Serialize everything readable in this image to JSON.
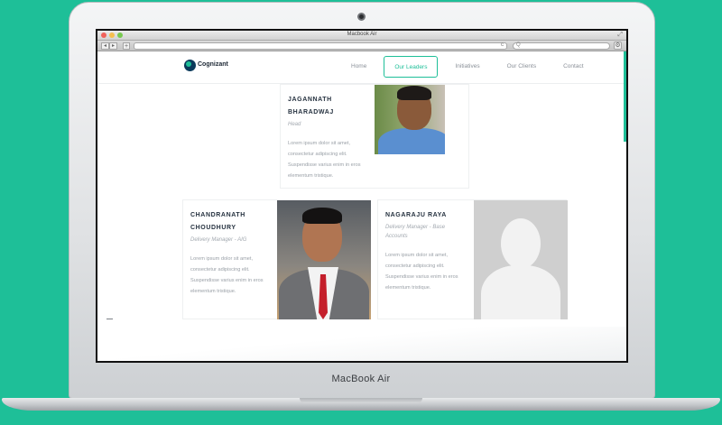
{
  "device": {
    "brand_label": "MacBook Air"
  },
  "browser": {
    "window_title": "Macbook Air",
    "back_icon": "chevron-left-icon",
    "forward_icon": "chevron-right-icon",
    "new_tab_symbol": "+",
    "reload_symbol": "c",
    "search_symbol": "Q",
    "settings_symbol": "⚙"
  },
  "site": {
    "logo_text": "Cognizant",
    "nav": [
      {
        "label": "Home",
        "active": false
      },
      {
        "label": "Our Leaders",
        "active": true
      },
      {
        "label": "Initiatives",
        "active": false
      },
      {
        "label": "Our Clients",
        "active": false
      },
      {
        "label": "Contact",
        "active": false
      }
    ],
    "accent_color": "#1ebf98"
  },
  "leaders": [
    {
      "name_line1": "JAGANNATH",
      "name_line2": "BHARADWAJ",
      "role": "Head",
      "desc": [
        "Lorem ipsum dolor sit amet,",
        "consectetur adipiscing elit.",
        "Suspendisse varius enim in eros",
        "elementum tristique."
      ]
    },
    {
      "name_line1": "CHANDRANATH",
      "name_line2": "CHOUDHURY",
      "role": "Delivery Manager - AIG",
      "desc": [
        "Lorem ipsum dolor sit amet,",
        "consectetur adipiscing elit.",
        "Suspendisse varius enim in eros",
        "elementum tristique."
      ]
    },
    {
      "name_line1": "NAGARAJU RAYA",
      "role_line1": "Delivery Manager - Base",
      "role_line2": "Accounts",
      "desc": [
        "Lorem ipsum dolor sit amet,",
        "consectetur adipiscing elit.",
        "Suspendisse varius enim in eros",
        "elementum tristique."
      ]
    }
  ]
}
